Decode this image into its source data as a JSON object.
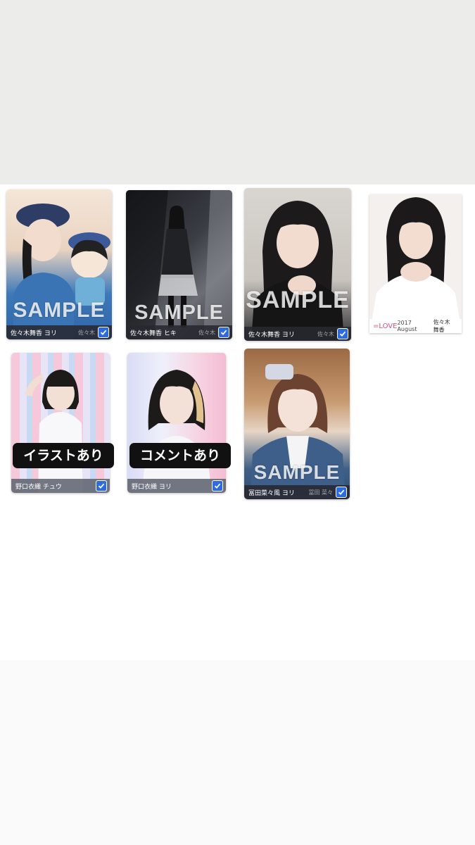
{
  "watermark": "SAMPLE",
  "cards": [
    {
      "name": "佐々木舞香 ヨリ",
      "extra": "佐々木",
      "checked": true
    },
    {
      "name": "佐々木舞香 ヒキ",
      "extra": "佐々木",
      "checked": true
    },
    {
      "name": "佐々木舞香 ヨリ",
      "extra": "佐々木",
      "checked": true
    },
    {
      "brand": "=LOVE",
      "date": "2017 August",
      "name": "佐々木 舞香"
    },
    {
      "name": "野口衣織 チュウ",
      "badge": "イラストあり",
      "checked": true
    },
    {
      "name": "野口衣織 ヨリ",
      "badge": "コメントあり",
      "checked": true
    },
    {
      "name": "冨田菜々風 ヨリ",
      "extra": "冨田 菜々",
      "checked": true
    }
  ],
  "colors": {
    "check": "#2f6be0",
    "badge_bg": "#111111"
  }
}
